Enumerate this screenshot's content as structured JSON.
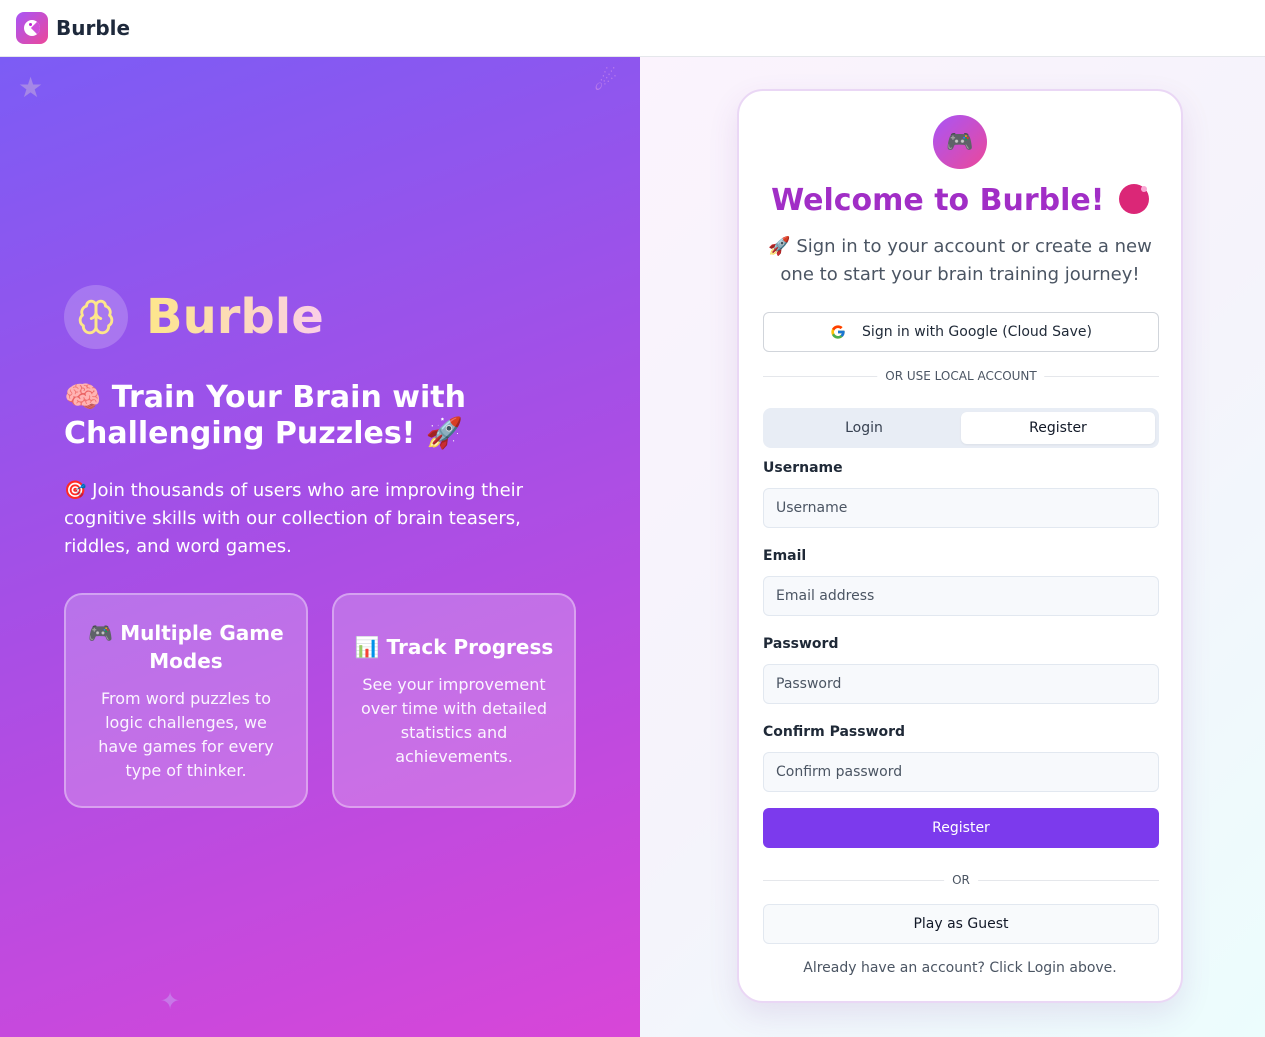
{
  "header": {
    "brand": "Burble"
  },
  "hero": {
    "brand": "Burble",
    "title": "🧠 Train Your Brain with Challenging Puzzles! 🚀",
    "description": "🎯 Join thousands of users who are improving their cognitive skills with our collection of brain teasers, riddles, and word games.",
    "features": [
      {
        "title": "🎮 Multiple Game Modes",
        "text": "From word puzzles to logic challenges, we have games for every type of thinker."
      },
      {
        "title": "📊 Track Progress",
        "text": "See your improvement over time with detailed statistics and achievements."
      }
    ]
  },
  "auth": {
    "avatar_icon": "🎮",
    "welcome": "Welcome to Burble!",
    "subtitle": "🚀 Sign in to your account or create a new one to start your brain training journey!",
    "google_button": "Sign in with Google (Cloud Save)",
    "divider_local": "OR USE LOCAL ACCOUNT",
    "tabs": [
      {
        "label": "Login"
      },
      {
        "label": "Register"
      }
    ],
    "active_tab": "Register",
    "fields": {
      "username": {
        "label": "Username",
        "placeholder": "Username",
        "value": ""
      },
      "email": {
        "label": "Email",
        "placeholder": "Email address",
        "value": ""
      },
      "password": {
        "label": "Password",
        "placeholder": "Password",
        "value": ""
      },
      "confirm": {
        "label": "Confirm Password",
        "placeholder": "Confirm password",
        "value": ""
      }
    },
    "register_button": "Register",
    "divider_or": "OR",
    "guest_button": "Play as Guest",
    "footnote": "Already have an account? Click Login above."
  },
  "colors": {
    "accent": "#7c3aed",
    "welcome": "#a12ec6",
    "hero_start": "#7c5cf5",
    "hero_end": "#d846d8"
  },
  "icons": {
    "brand": "pacman-icon",
    "hero": "brain-icon",
    "google": "google-icon",
    "deco": [
      "star-icon",
      "comet-icon",
      "sparkle-icon"
    ]
  }
}
